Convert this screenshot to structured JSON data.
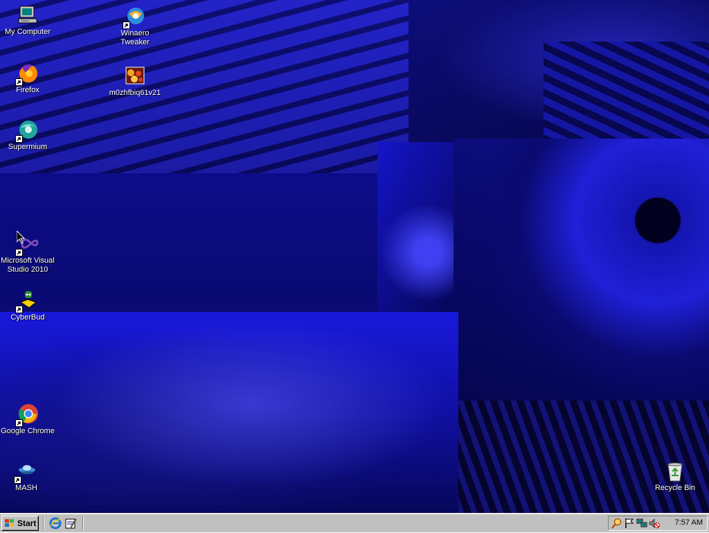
{
  "desktop": {
    "icons": [
      {
        "label": "My Computer",
        "icon": "computer-icon"
      },
      {
        "label": "Winaero Tweaker",
        "icon": "winaero-icon"
      },
      {
        "label": "Firefox",
        "icon": "firefox-icon"
      },
      {
        "label": "m0zhfbiq61v21",
        "icon": "image-file-icon"
      },
      {
        "label": "Supermium",
        "icon": "supermium-icon"
      },
      {
        "label": "Microsoft Visual Studio 2010",
        "icon": "visual-studio-icon"
      },
      {
        "label": "CyberBud",
        "icon": "cyberbud-icon"
      },
      {
        "label": "Google Chrome",
        "icon": "chrome-icon"
      },
      {
        "label": "MASH",
        "icon": "mash-icon"
      },
      {
        "label": "Recycle Bin",
        "icon": "recycle-bin-icon"
      }
    ]
  },
  "taskbar": {
    "start_label": "Start",
    "quick_launch": [
      "internet-explorer-icon",
      "notepad-icon"
    ],
    "tray_icons": [
      "search-icon",
      "flag-icon",
      "network-icon",
      "volume-muted-icon"
    ],
    "clock": "7:57 AM"
  },
  "colors": {
    "taskbar_bg": "#c0c0c0",
    "desktop_blue": "#0a0a66",
    "label_text": "#ffffff"
  }
}
